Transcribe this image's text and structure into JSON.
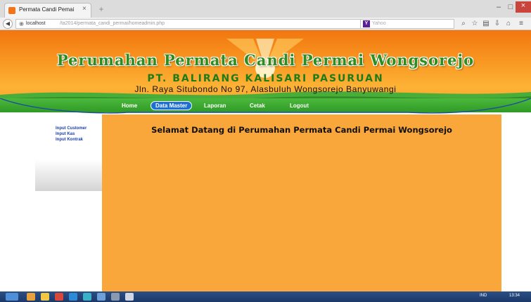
{
  "browser": {
    "tab_title": "Permata Candi Pemai",
    "tab_close": "×",
    "new_tab": "+",
    "window_buttons": {
      "minimize": "–",
      "maximize": "□",
      "close": "×"
    },
    "url_host": "localhost",
    "url_path": "/ta2014/permata_candi_permai/homeadmin.php",
    "search_placeholder": "Yahoo"
  },
  "header": {
    "site_title": "Perumahan  Permata Candi  Permai Wongsorejo",
    "company": "PT. BALIRANG KALISARI PASURUAN",
    "address": "Jln.  Raya  Situbondo  No  97,  Alasbuluh  Wongsorejo  Banyuwangi"
  },
  "menu": {
    "items": [
      {
        "label": "Home"
      },
      {
        "label": "Data Master",
        "active": true
      },
      {
        "label": "Laporan"
      },
      {
        "label": "Cetak"
      },
      {
        "label": "Logout"
      }
    ],
    "active_color": "#1d6fd4"
  },
  "sidebar": {
    "links": [
      {
        "label": "Input Customer"
      },
      {
        "label": "Input Kas"
      },
      {
        "label": "Input Kontrak"
      }
    ]
  },
  "main": {
    "welcome": "Selamat Datang di Perumahan Permata Candi Permai Wongsorejo",
    "background_color": "#f9a63b"
  },
  "taskbar": {
    "language": "IND",
    "clock": "13:34"
  },
  "colors": {
    "header_orange": "#f99a24",
    "header_green": "#2e8c22",
    "menu_green": "#3aa82e",
    "link_blue": "#1e3fa8"
  }
}
